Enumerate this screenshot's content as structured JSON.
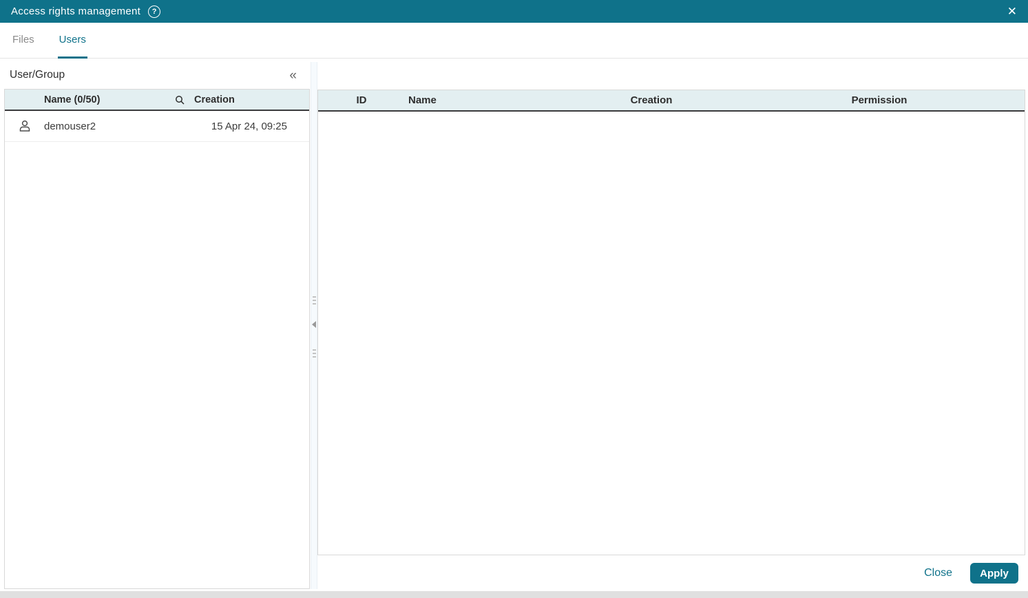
{
  "dialog": {
    "title": "Access rights management"
  },
  "icons": {
    "help": "?",
    "close": "✕",
    "collapse": "«"
  },
  "tabs": [
    {
      "label": "Files",
      "active": false
    },
    {
      "label": "Users",
      "active": true
    }
  ],
  "left_panel": {
    "title": "User/Group",
    "table": {
      "headers": {
        "name": "Name (0/50)",
        "creation": "Creation"
      },
      "rows": [
        {
          "name": "demouser2",
          "creation": "15 Apr 24, 09:25"
        }
      ]
    }
  },
  "right_panel": {
    "table": {
      "headers": [
        "ID",
        "Name",
        "Creation",
        "Permission"
      ],
      "rows": []
    }
  },
  "footer": {
    "close_label": "Close",
    "apply_label": "Apply"
  },
  "colors": {
    "accent_teal": "#0f728a",
    "table_header_bg": "#e3eff1",
    "header_underline": "#3a3a3c",
    "inactive_tab": "#8a8a8a",
    "bottom_strip": "#e0e0e0"
  }
}
